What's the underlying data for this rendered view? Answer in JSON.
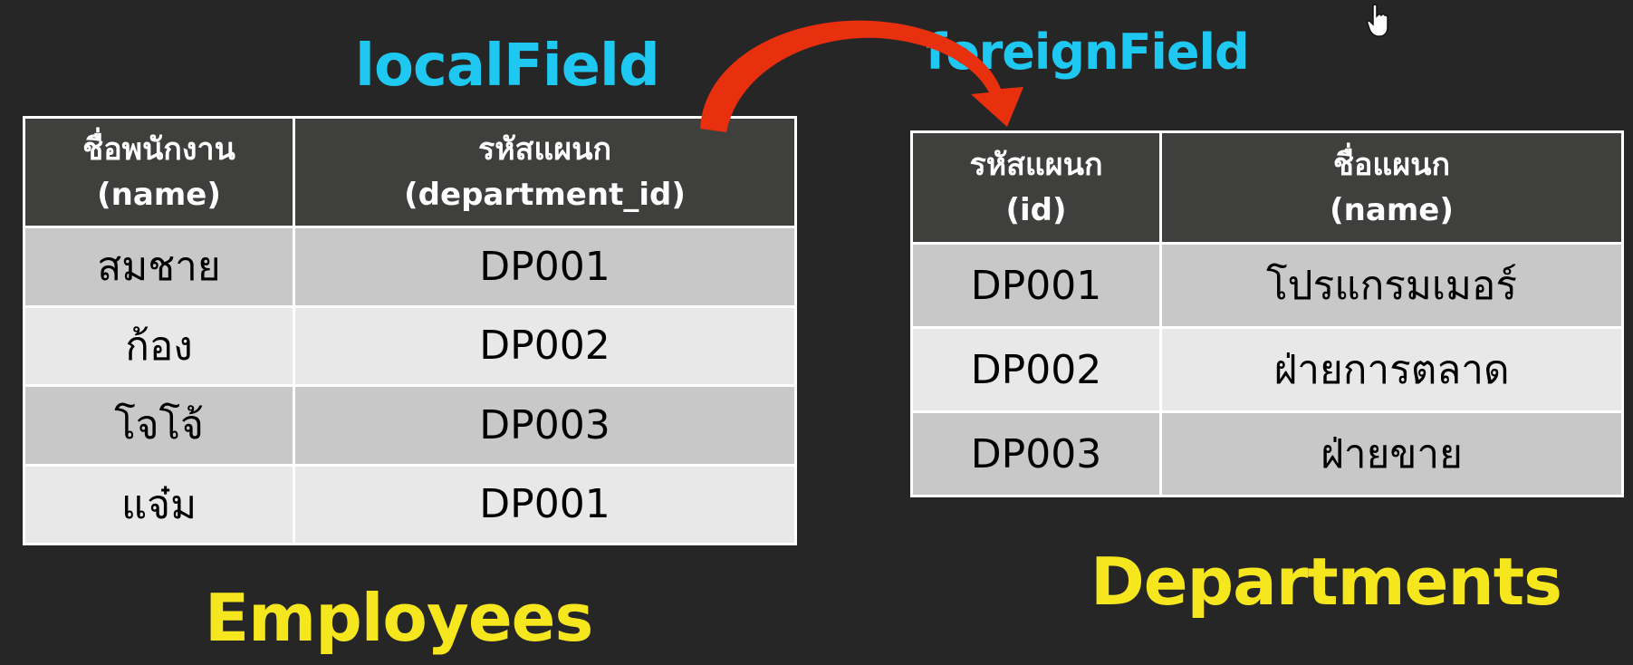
{
  "colors": {
    "background": "#262626",
    "field_label": "#1ec8f0",
    "table_title": "#f5e61e",
    "header_bg": "#3f3f3d",
    "row_odd": "#c8c8c8",
    "row_even": "#e8e8e8",
    "arrow": "#e8300f"
  },
  "labels": {
    "local_field": "localField",
    "foreign_field": "foreignField"
  },
  "employees": {
    "title": "Employees",
    "columns": [
      {
        "thai": "ชื่อพนักงาน",
        "en": "(name)"
      },
      {
        "thai": "รหัสแผนก",
        "en": "(department_id)"
      }
    ],
    "rows": [
      [
        "สมชาย",
        "DP001"
      ],
      [
        "ก้อง",
        "DP002"
      ],
      [
        "โจโจ้",
        "DP003"
      ],
      [
        "แจ๋ม",
        "DP001"
      ]
    ]
  },
  "departments": {
    "title": "Departments",
    "columns": [
      {
        "thai": "รหัสแผนก",
        "en": "(id)"
      },
      {
        "thai": "ชื่อแผนก",
        "en": "(name)"
      }
    ],
    "rows": [
      [
        "DP001",
        "โปรแกรมเมอร์"
      ],
      [
        "DP002",
        "ฝ่ายการตลาด"
      ],
      [
        "DP003",
        "ฝ่ายขาย"
      ]
    ]
  },
  "icons": {
    "arrow": "curved-arrow-icon",
    "cursor": "cursor-icon"
  }
}
